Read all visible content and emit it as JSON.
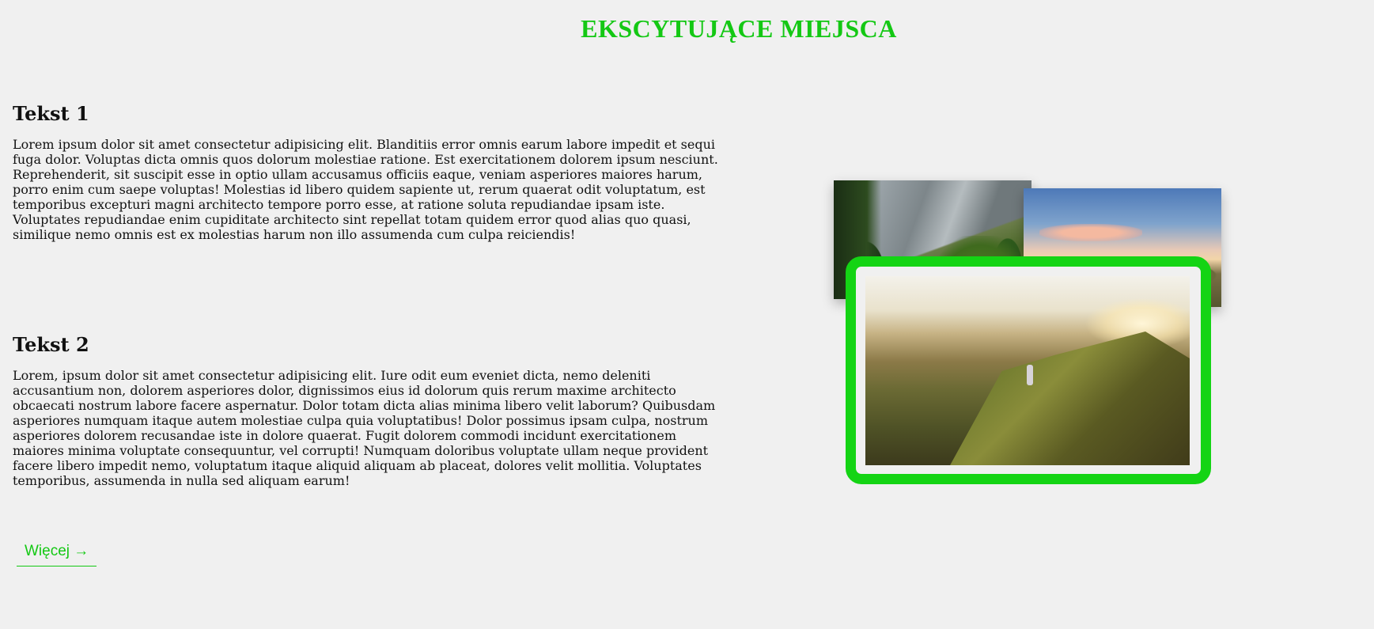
{
  "header": {
    "title": "EKSCYTUJĄCE MIEJSCA"
  },
  "sections": [
    {
      "heading": "Tekst 1",
      "body": "Lorem ipsum dolor sit amet consectetur adipisicing elit. Blanditiis error omnis earum labore impedit et sequi fuga dolor. Voluptas dicta omnis quos dolorum molestiae ratione. Est exercitationem dolorem ipsum nesciunt. Reprehenderit, sit suscipit esse in optio ullam accusamus officiis eaque, veniam asperiores maiores harum, porro enim cum saepe voluptas! Molestias id libero quidem sapiente ut, rerum quaerat odit voluptatum, est temporibus excepturi magni architecto tempore porro esse, at ratione soluta repudiandae ipsam iste. Voluptates repudiandae enim cupiditate architecto sint repellat totam quidem error quod alias quo quasi, similique nemo omnis est ex molestias harum non illo assumenda cum culpa reiciendis!"
    },
    {
      "heading": "Tekst 2",
      "body": "Lorem, ipsum dolor sit amet consectetur adipisicing elit. Iure odit eum eveniet dicta, nemo deleniti accusantium non, dolorem asperiores dolor, dignissimos eius id dolorum quis rerum maxime architecto obcaecati nostrum labore facere aspernatur. Dolor totam dicta alias minima libero velit laborum? Quibusdam asperiores numquam itaque autem molestiae culpa quia voluptatibus! Dolor possimus ipsam culpa, nostrum asperiores dolorem recusandae iste in dolore quaerat. Fugit dolorem commodi incidunt exercitationem maiores minima voluptate consequuntur, vel corrupti! Numquam doloribus voluptate ullam neque provident facere libero impedit nemo, voluptatum itaque aliquid aliquam ab placeat, dolores velit mollitia. Voluptates temporibus, assumenda in nulla sed aliquam earum!"
    }
  ],
  "more_link": {
    "label": "Więcej →"
  },
  "colors": {
    "accent": "#14c814",
    "frame": "#14d414",
    "background": "#f0f0f0"
  }
}
